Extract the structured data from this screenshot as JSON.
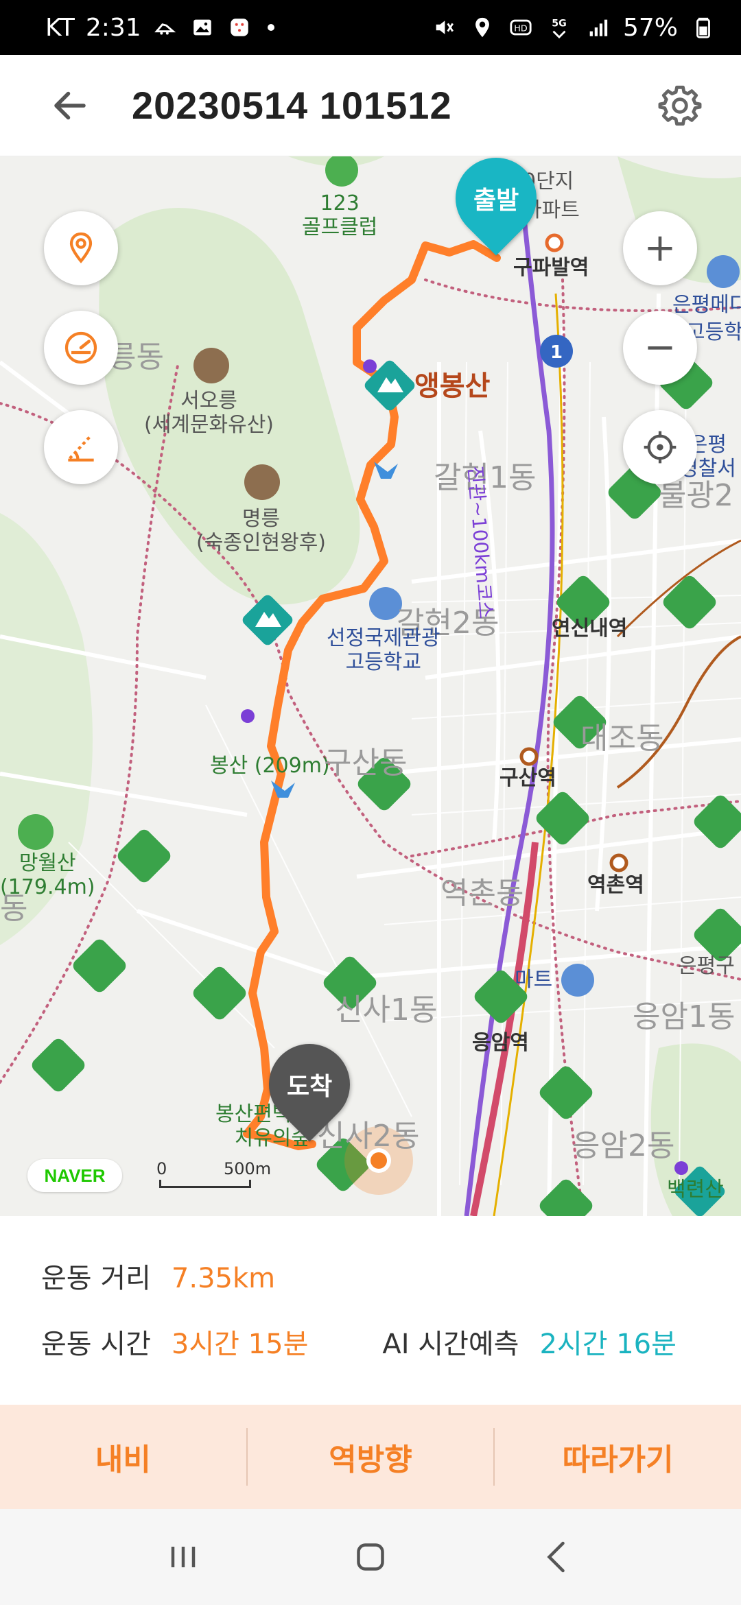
{
  "status_bar": {
    "carrier": "KT",
    "time": "2:31",
    "battery": "57%",
    "network": "5G",
    "hd": "HD"
  },
  "app_bar": {
    "title": "20230514 101512",
    "back_icon": "arrow-left-icon",
    "settings_icon": "gear-icon"
  },
  "map": {
    "start_label": "출발",
    "end_label": "도착",
    "provider": "NAVER",
    "scale": {
      "zero": "0",
      "distance": "500m"
    },
    "controls": {
      "zoom_in": "+",
      "zoom_out": "−"
    },
    "labels": {
      "golf": "123\n골프클럽",
      "apartment": "아파트",
      "dong_top": "0단지",
      "gupabal": "구파발역",
      "eunpyeong_meditech": "은평메디",
      "high_school_right": "고등학",
      "neung_dong": "릉동",
      "seooreung": "서오릉\n(세계문화유산)",
      "myeongneung": "명릉\n(숙종인현왕후)",
      "aengbongsan": "앵봉산",
      "galhyeon1": "갈현1동",
      "galhyeon2": "갈현2동",
      "eunpyeong_police": "은평\n경찰서",
      "bulgwang": "불광2",
      "jingwan_course": "진관~100km코스",
      "yeonsinnae": "연신내역",
      "seonjeong": "선정국제관광\n고등학교",
      "bongsan": "봉산 (209m)",
      "gusan_dong": "구산동",
      "daejo_dong": "대조동",
      "gusan_station": "구산역",
      "mangwolsan": "망월산\n(179.4m)",
      "dong_left": "동",
      "yeokchon_dong": "역촌동",
      "yeokchon_station": "역촌역",
      "eunpyeong_gu": "은평구",
      "sinsa1": "신사1동",
      "mart": "마트",
      "eungam_station": "응암역",
      "eungam1": "응암1동",
      "healing_forest": "봉산편백나무\n치유의숲",
      "sinsa2": "신사2동",
      "eungam2": "응암2동",
      "baekryeonsan": "백련산"
    }
  },
  "info": {
    "distance_label": "운동 거리",
    "distance_value": "7.35km",
    "time_label": "운동 시간",
    "time_value": "3시간 15분",
    "ai_label": "AI 시간예측",
    "ai_value": "2시간 16분"
  },
  "actions": {
    "navigate": "내비",
    "reverse": "역방향",
    "follow": "따라가기"
  },
  "colors": {
    "route": "#ff7f2a",
    "accent_orange": "#f58025",
    "teal": "#1ab3c0",
    "start_pin": "#19b6c4",
    "end_pin": "#555555"
  }
}
